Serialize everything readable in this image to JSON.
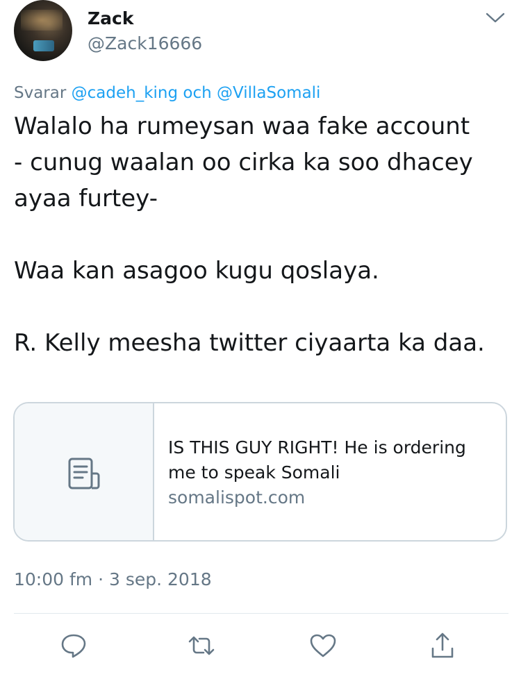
{
  "user": {
    "display_name": "Zack",
    "handle": "@Zack16666"
  },
  "reply": {
    "prefix": "Svarar",
    "mention_1": "@cadeh_king",
    "conjunction": "och",
    "mention_2": "@VillaSomali"
  },
  "tweet": {
    "line_1": "Walalo ha rumeysan waa fake account",
    "line_2": "- cunug waalan oo cirka ka soo dhacey",
    "line_3": "ayaa furtey-",
    "line_4": "Waa kan asagoo kugu qoslaya.",
    "line_5": "R. Kelly meesha twitter ciyaarta ka daa."
  },
  "card": {
    "title_line_1": "IS THIS GUY RIGHT! He is ordering",
    "title_line_2": "me to speak Somali",
    "domain": "somalispot.com",
    "icon": "document-icon"
  },
  "timestamp": "10:00 fm · 3 sep. 2018",
  "actions": [
    "reply-icon",
    "retweet-icon",
    "like-icon",
    "share-icon"
  ],
  "colors": {
    "text": "#14171a",
    "secondary": "#657786",
    "link": "#1da1f2",
    "border": "#ccd6dd"
  }
}
